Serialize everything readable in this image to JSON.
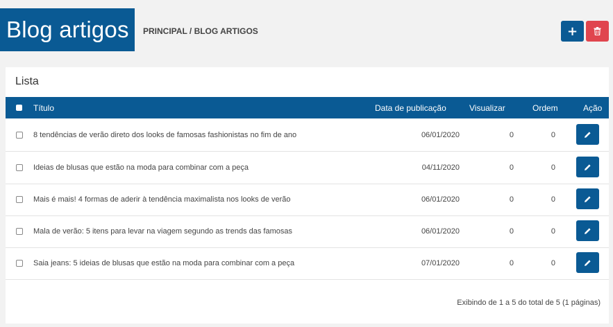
{
  "header": {
    "title": "Blog artigos",
    "breadcrumb": "PRINCIPAL / BLOG ARTIGOS",
    "add_label": "+",
    "add_color": "#0a5a94",
    "delete_icon": "trash-icon",
    "delete_color": "#e0454e"
  },
  "panel": {
    "title": "Lista"
  },
  "table": {
    "columns": {
      "titulo": "Título",
      "data": "Data de publicação",
      "visualizar": "Visualizar",
      "ordem": "Ordem",
      "acao": "Ação"
    },
    "rows": [
      {
        "titulo": "8 tendências de verão direto dos looks de famosas fashionistas no fim de ano",
        "data": "06/01/2020",
        "visualizar": "0",
        "ordem": "0"
      },
      {
        "titulo": "Ideias de blusas que estão na moda para combinar com a peça",
        "data": "04/11/2020",
        "visualizar": "0",
        "ordem": "0"
      },
      {
        "titulo": "Mais é mais! 4 formas de aderir à tendência maximalista nos looks de verão",
        "data": "06/01/2020",
        "visualizar": "0",
        "ordem": "0"
      },
      {
        "titulo": "Mala de verão: 5 itens para levar na viagem segundo as trends das famosas",
        "data": "06/01/2020",
        "visualizar": "0",
        "ordem": "0"
      },
      {
        "titulo": "Saia jeans: 5 ideias de blusas que estão na moda para combinar com a peça",
        "data": "07/01/2020",
        "visualizar": "0",
        "ordem": "0"
      }
    ],
    "edit_icon": "pencil-icon"
  },
  "footer": {
    "summary": "Exibindo de 1 a 5 do total de 5 (1 páginas)"
  },
  "colors": {
    "primary": "#0a5a94",
    "danger": "#e0454e",
    "background": "#f2f2f2"
  }
}
